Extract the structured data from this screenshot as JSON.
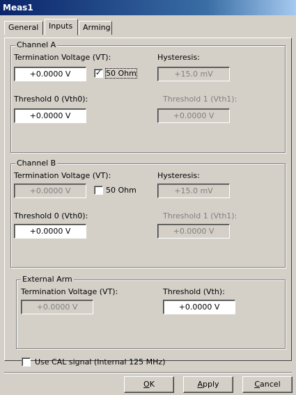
{
  "window": {
    "title": "Meas1"
  },
  "tabs": [
    {
      "label": "General",
      "active": false
    },
    {
      "label": "Inputs",
      "active": true
    },
    {
      "label": "Arming",
      "active": false
    }
  ],
  "channel_a": {
    "title": "Channel A",
    "termination_label": "Termination Voltage (VT):",
    "termination_value": "+0.0000  V",
    "ohm_label": "50 Ohm",
    "ohm_checked": true,
    "hysteresis_label": "Hysteresis:",
    "hysteresis_value": "+15.0 mV",
    "threshold0_label": "Threshold 0 (Vth0):",
    "threshold0_value": "+0.0000  V",
    "threshold1_label": "Threshold 1 (Vth1):",
    "threshold1_value": "+0.0000  V"
  },
  "channel_b": {
    "title": "Channel B",
    "termination_label": "Termination Voltage (VT):",
    "termination_value": "+0.0000  V",
    "ohm_label": "50 Ohm",
    "ohm_checked": false,
    "hysteresis_label": "Hysteresis:",
    "hysteresis_value": "+15.0 mV",
    "threshold0_label": "Threshold 0 (Vth0):",
    "threshold0_value": "+0.0000  V",
    "threshold1_label": "Threshold 1 (Vth1):",
    "threshold1_value": "+0.0000  V"
  },
  "external_arm": {
    "title": "External Arm",
    "termination_label": "Termination Voltage (VT):",
    "termination_value": "+0.0000  V",
    "threshold_label": "Threshold (Vth):",
    "threshold_value": "+0.0000  V"
  },
  "cal_signal": {
    "label": "Use CAL signal (Internal 125 MHz)",
    "checked": false
  },
  "buttons": {
    "ok_mnemonic": "O",
    "ok_rest": "K",
    "apply_mnemonic": "A",
    "apply_rest": "pply",
    "cancel_mnemonic": "C",
    "cancel_rest": "ancel"
  }
}
